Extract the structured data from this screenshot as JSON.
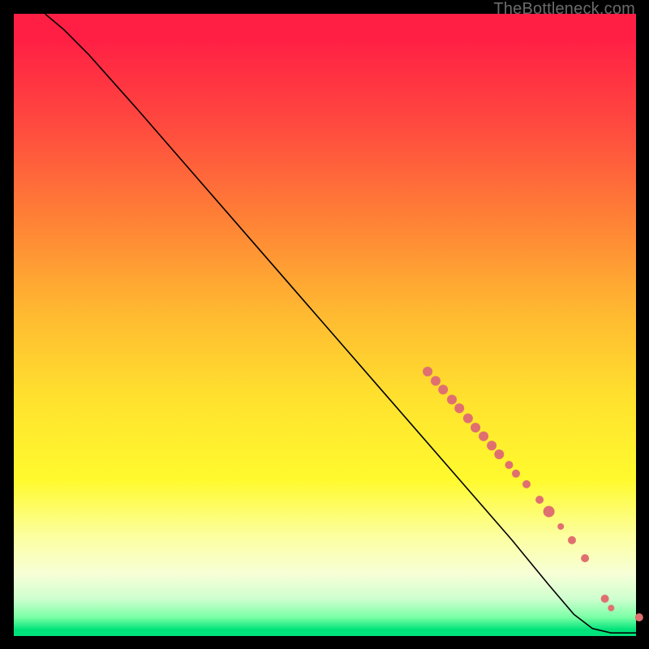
{
  "watermark": "TheBottleneck.com",
  "colors": {
    "dot": "#e07070",
    "line": "#000000"
  },
  "chart_data": {
    "type": "line",
    "title": "",
    "xlabel": "",
    "ylabel": "",
    "xlim": [
      0,
      100
    ],
    "ylim": [
      0,
      100
    ],
    "note": "Axes are percent-of-plot coordinates (0 left/bottom → 100 right/top). Values read from pixel positions; chart has no numeric tick labels.",
    "curve": [
      {
        "x": 5,
        "y": 100
      },
      {
        "x": 8,
        "y": 97.5
      },
      {
        "x": 12,
        "y": 93.5
      },
      {
        "x": 20,
        "y": 84.5
      },
      {
        "x": 30,
        "y": 73
      },
      {
        "x": 40,
        "y": 61.5
      },
      {
        "x": 50,
        "y": 50
      },
      {
        "x": 60,
        "y": 38.5
      },
      {
        "x": 70,
        "y": 27
      },
      {
        "x": 80,
        "y": 15.5
      },
      {
        "x": 86,
        "y": 8.2
      },
      {
        "x": 90,
        "y": 3.5
      },
      {
        "x": 93,
        "y": 1.2
      },
      {
        "x": 96,
        "y": 0.5
      },
      {
        "x": 100,
        "y": 0.5
      }
    ],
    "dots": [
      {
        "x": 66.5,
        "y": 42.5,
        "r": 6
      },
      {
        "x": 67.8,
        "y": 41.0,
        "r": 6
      },
      {
        "x": 69.0,
        "y": 39.6,
        "r": 6
      },
      {
        "x": 70.4,
        "y": 38.0,
        "r": 6
      },
      {
        "x": 71.6,
        "y": 36.6,
        "r": 6
      },
      {
        "x": 73.0,
        "y": 35.0,
        "r": 6
      },
      {
        "x": 74.2,
        "y": 33.5,
        "r": 6
      },
      {
        "x": 75.5,
        "y": 32.1,
        "r": 6
      },
      {
        "x": 76.8,
        "y": 30.6,
        "r": 6
      },
      {
        "x": 78.0,
        "y": 29.2,
        "r": 6
      },
      {
        "x": 79.6,
        "y": 27.5,
        "r": 5
      },
      {
        "x": 80.7,
        "y": 26.1,
        "r": 5
      },
      {
        "x": 82.4,
        "y": 24.4,
        "r": 5
      },
      {
        "x": 84.5,
        "y": 21.9,
        "r": 5
      },
      {
        "x": 86.0,
        "y": 20.0,
        "r": 7
      },
      {
        "x": 87.9,
        "y": 17.6,
        "r": 4
      },
      {
        "x": 89.7,
        "y": 15.4,
        "r": 5
      },
      {
        "x": 91.8,
        "y": 12.5,
        "r": 5
      },
      {
        "x": 95.0,
        "y": 6.0,
        "r": 5
      },
      {
        "x": 96.0,
        "y": 4.5,
        "r": 4
      },
      {
        "x": 100.5,
        "y": 3.0,
        "r": 5
      }
    ]
  }
}
